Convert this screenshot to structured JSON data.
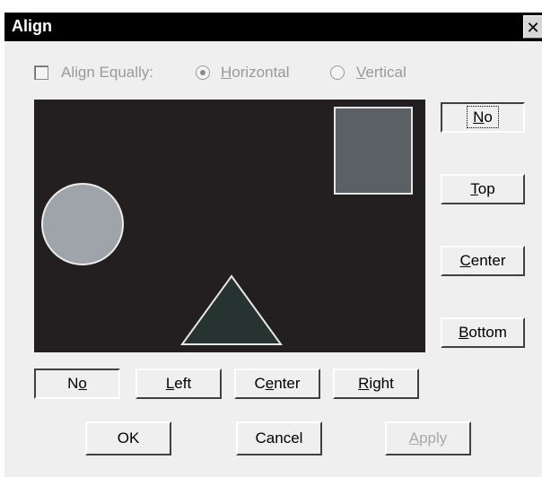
{
  "window": {
    "title": "Align",
    "close_glyph": "✕"
  },
  "options": {
    "align_equally": {
      "label": "Align Equally:",
      "checked": false,
      "enabled": false
    },
    "orientation": {
      "horizontal": {
        "label_prefix": "",
        "mnemonic": "H",
        "label_rest": "orizontal",
        "selected": true
      },
      "vertical": {
        "label_prefix": "",
        "mnemonic": "V",
        "label_rest": "ertical",
        "selected": false
      }
    }
  },
  "preview": {
    "background": "#231f20",
    "shapes": [
      {
        "kind": "rectangle",
        "fill": "#5a6063",
        "outline": "#e6e6e6"
      },
      {
        "kind": "circle",
        "fill": "#9fa4ab",
        "outline": "#ececec"
      },
      {
        "kind": "triangle",
        "fill": "#263330",
        "outline": "#e6e6e6"
      }
    ]
  },
  "vertical_align": {
    "no": {
      "pre": "",
      "mn": "N",
      "post": "o"
    },
    "top": {
      "pre": "",
      "mn": "T",
      "post": "op"
    },
    "center": {
      "pre": "",
      "mn": "C",
      "post": "enter"
    },
    "bottom": {
      "pre": "",
      "mn": "B",
      "post": "ottom"
    }
  },
  "horizontal_align": {
    "no": {
      "pre": "N",
      "mn": "o",
      "post": ""
    },
    "left": {
      "pre": "",
      "mn": "L",
      "post": "eft"
    },
    "center": {
      "pre": "C",
      "mn": "e",
      "post": "nter"
    },
    "right": {
      "pre": "",
      "mn": "R",
      "post": "ight"
    }
  },
  "dialog_buttons": {
    "ok": "OK",
    "cancel": "Cancel",
    "apply": {
      "pre": "",
      "mn": "A",
      "post": "pply",
      "enabled": false
    }
  }
}
